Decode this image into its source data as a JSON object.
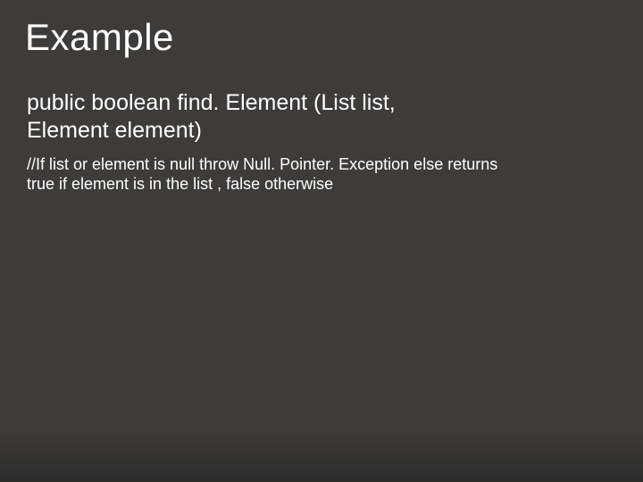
{
  "slide": {
    "title": "Example",
    "code_line1": "public boolean find. Element (List list,",
    "code_line2": "Element element)",
    "comment_line1": "//If list or element is null throw Null. Pointer. Exception else returns",
    "comment_line2": "true if element is in the list , false otherwise"
  }
}
